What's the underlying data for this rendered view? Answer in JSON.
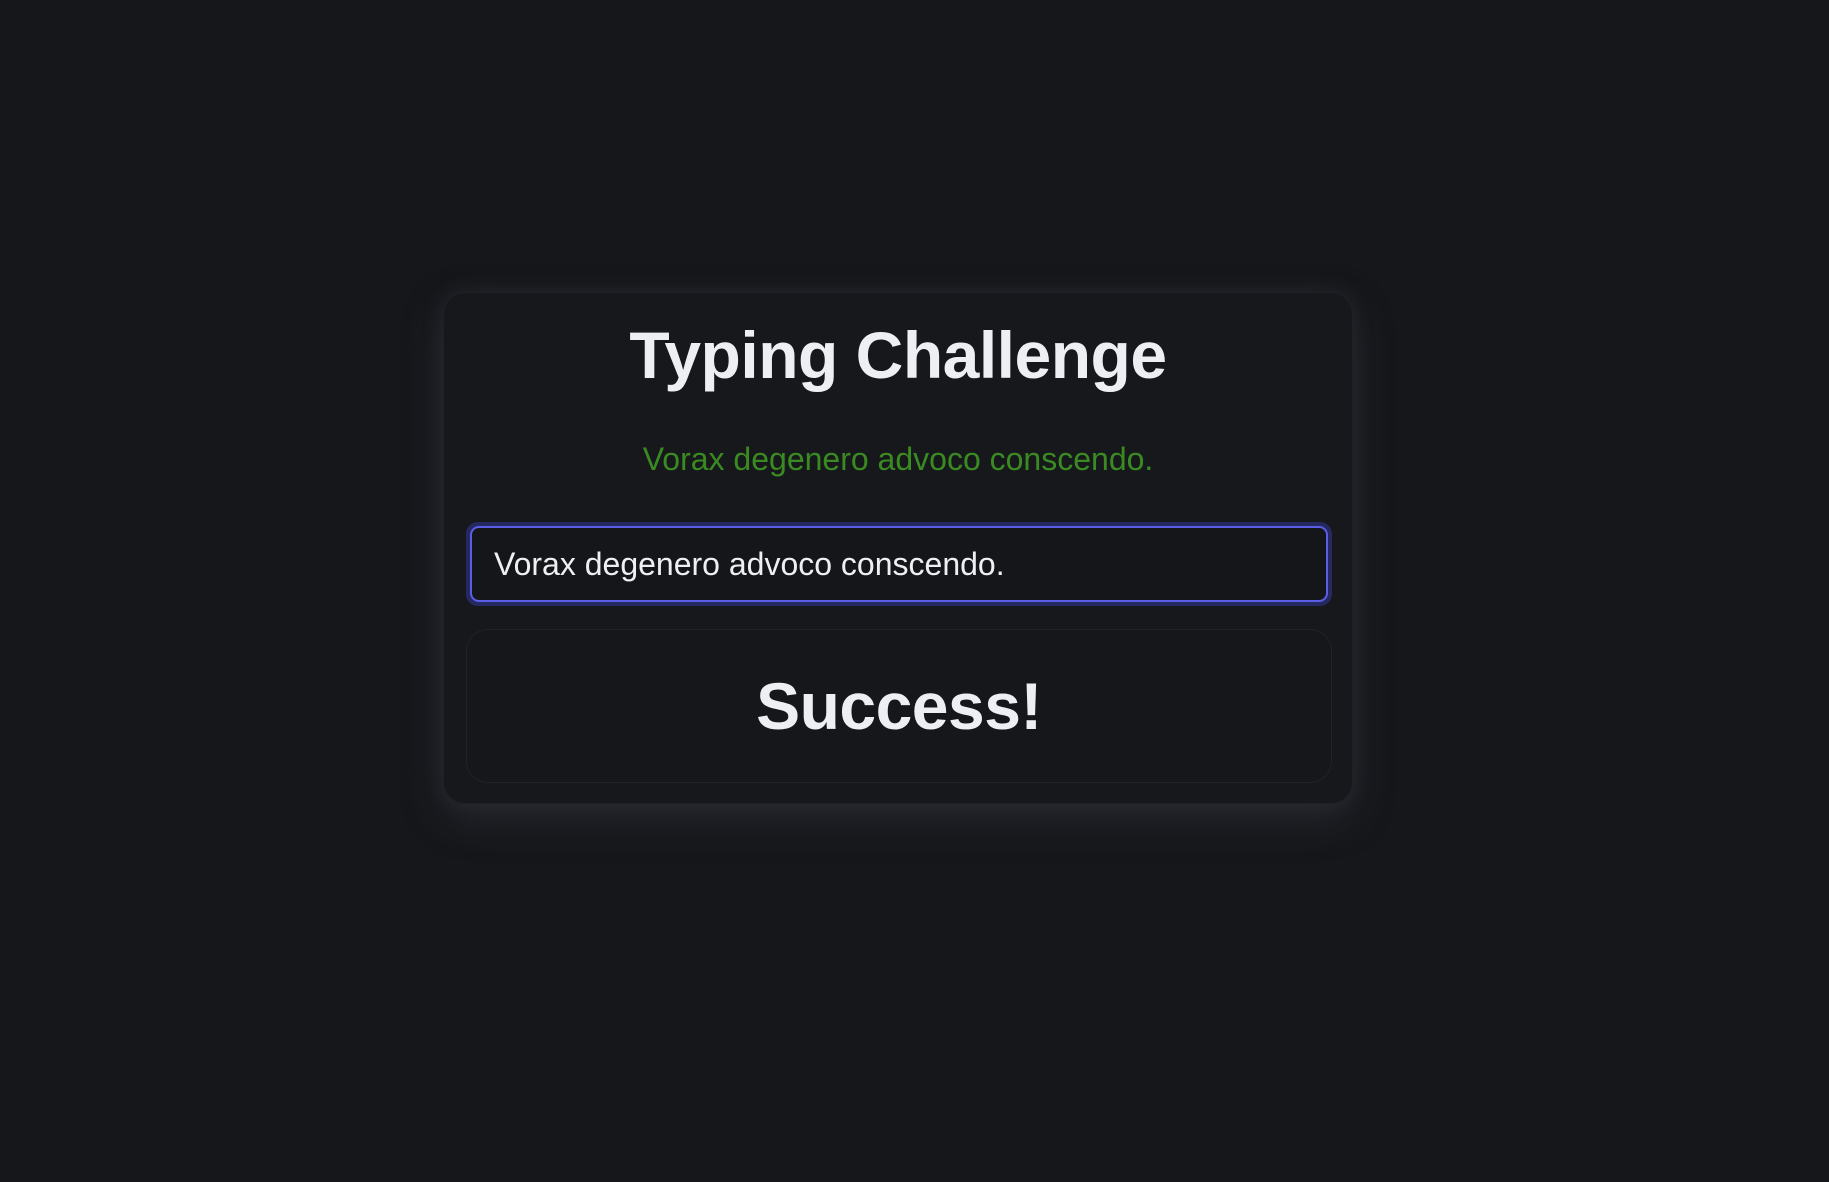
{
  "page": {
    "title": "Typing Challenge"
  },
  "challenge": {
    "prompt_text": "Vorax degenero advoco conscendo.",
    "prompt_color": "#3a8a22",
    "input_value": "Vorax degenero advoco conscendo.",
    "result_text": "Success!"
  },
  "colors": {
    "background": "#16171b",
    "accent": "#5a5ee6",
    "text": "#eeeff3"
  }
}
